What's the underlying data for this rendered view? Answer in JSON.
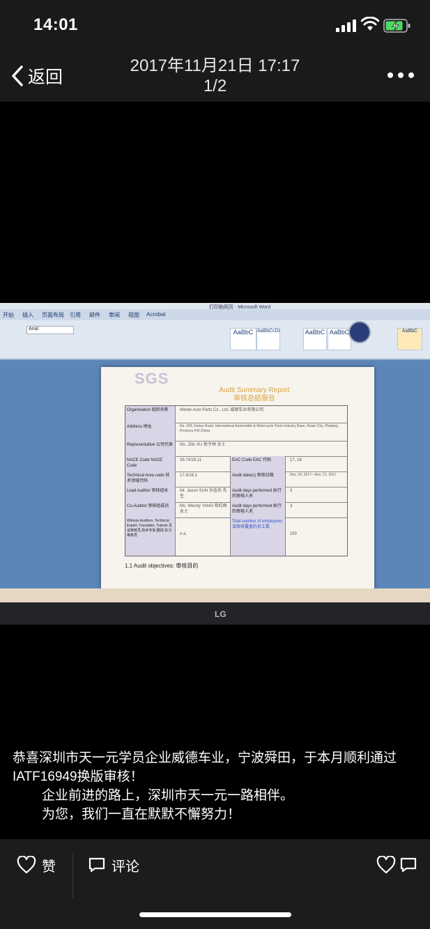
{
  "status": {
    "time": "14:01"
  },
  "nav": {
    "back_label": "返回",
    "title_line1": "2017年11月21日 17:17",
    "title_line2": "1/2"
  },
  "photo": {
    "ribbon_tabs": [
      "开始",
      "插入",
      "页面布局",
      "引用",
      "邮件",
      "审阅",
      "视图",
      "Acrobat"
    ],
    "window_title": "打印助网页 - Microsoft Word",
    "font_name": "Arial",
    "styles": [
      "AaBbC",
      "AaBbCcDi",
      "AaBbC",
      "AaBbC",
      "AaBbC"
    ],
    "sgs_logo": "SGS",
    "doc_title_en": "Audit Summary Report",
    "doc_title_cn": "审核总结报告",
    "rows": [
      {
        "label": "Organisation 组织名称",
        "value": "Weide Auto Parts Co., Ltd. 威德车业有限公司"
      },
      {
        "label": "Address 地址",
        "value": "No. 399, Kaituo Road, International Automobile & Motorcycle Parts Industry Base, Ruian City, Zhejiang Province P.R.China"
      },
      {
        "label": "Representative 公司代表",
        "value": "Ms. Zilin XU 徐子林 女士"
      },
      {
        "label": "NACE Code NACE Code",
        "value": "29.74/29.11",
        "mid": "EAC Code EAC 代码",
        "right": "17, 18"
      },
      {
        "label": "Technical Area code 技术领域代码",
        "value": "17.4/18.1",
        "mid": "Audit date(s) 审核日期",
        "right": "Nov. 20, 2017—Nov. 21, 2017"
      },
      {
        "label": "Lead Auditor 审核组长",
        "value": "Mr. Jason SUN 孙金苏 先生",
        "mid": "Audit days performed 执行的审核人天",
        "right": "3"
      },
      {
        "label": "Co-Auditor 审核组成员",
        "value": "Ms. Wendy YANG 杨红梅 女士",
        "mid": "Audit days performed 执行的审核人天",
        "right": "3"
      },
      {
        "label": "Witness Auditors, Technical Expert, Translator, Trainee 见证审核员,技术专家,翻译,实习审核员",
        "value": "n.a.",
        "mid": "Total number of employees 该审核覆盖的员工数",
        "right": "150"
      }
    ],
    "objectives": "1.1 Audit objectives: 审核目的",
    "brand": "LG"
  },
  "caption": {
    "line1": "恭喜深圳市天一元学员企业威德车业，宁波舜田，于本月顺利通过IATF16949换版审核！",
    "line2": "企业前进的路上，深圳市天一元一路相伴。",
    "line3": "为您，我们一直在默默不懈努力！"
  },
  "actions": {
    "like_label": "赞",
    "comment_label": "评论"
  },
  "colors": {
    "background": "#000000",
    "bar": "#1c1c1e",
    "text": "#ffffff"
  }
}
